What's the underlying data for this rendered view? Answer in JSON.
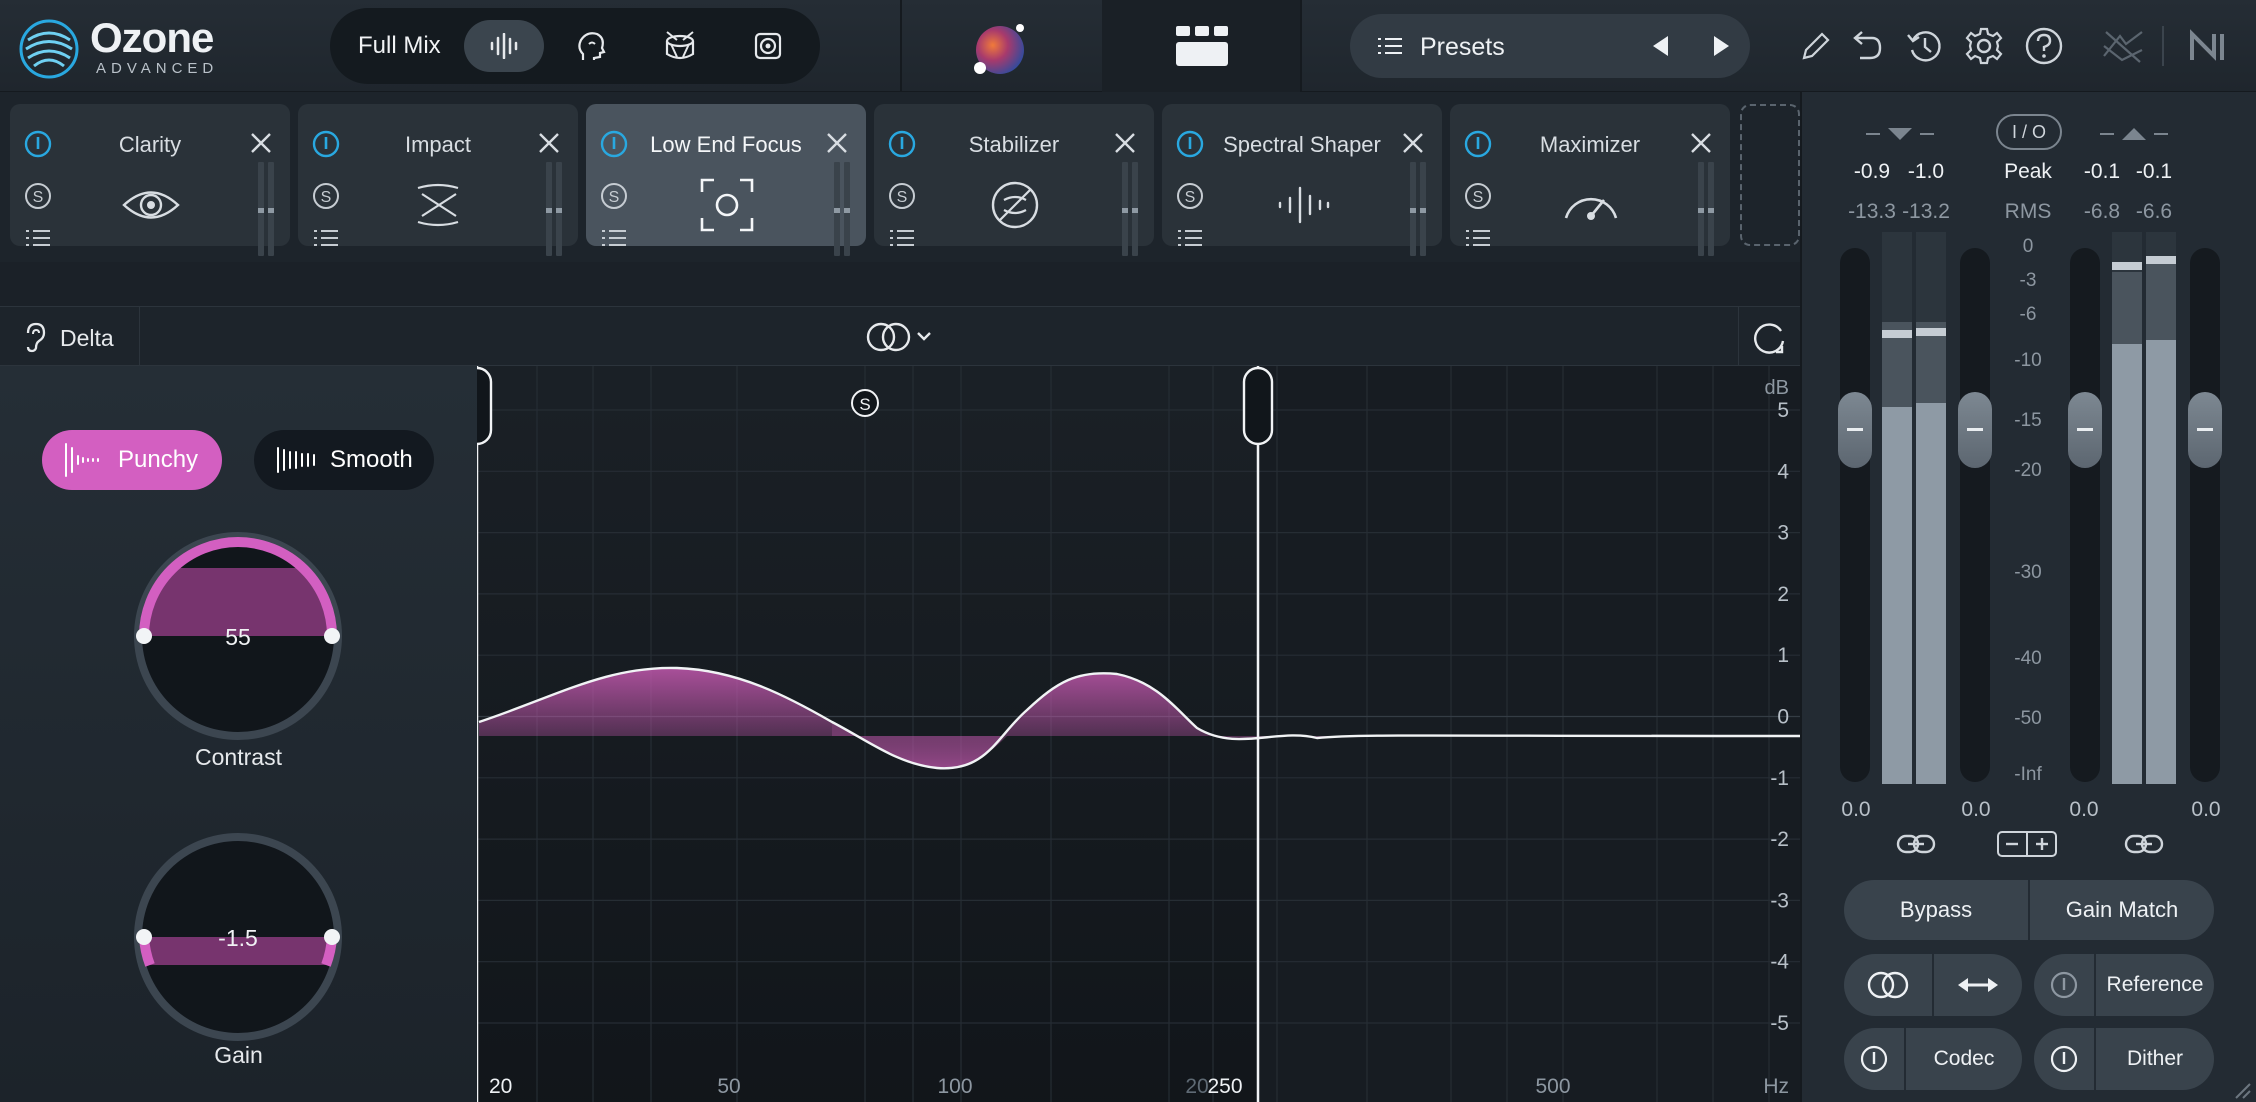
{
  "app": {
    "name": "Ozone",
    "edition": "ADVANCED",
    "accent_color": "#d35fc1",
    "focus_color": "#29a8e0"
  },
  "topbar": {
    "mix_label": "Full Mix",
    "mix_targets": [
      "waveform-icon",
      "vocal-head-icon",
      "drum-icon",
      "speaker-icon"
    ],
    "presets_label": "Presets",
    "tools": [
      "pencil-icon",
      "undo-icon",
      "history-icon",
      "gear-icon",
      "help-icon",
      "assistant-off-icon",
      "ni-logo-icon"
    ]
  },
  "modules": [
    {
      "name": "Clarity",
      "icon": "eye-icon",
      "selected": false
    },
    {
      "name": "Impact",
      "icon": "impact-icon",
      "selected": false
    },
    {
      "name": "Low End Focus",
      "icon": "focus-frame-icon",
      "selected": true
    },
    {
      "name": "Stabilizer",
      "icon": "stabilizer-icon",
      "selected": false
    },
    {
      "name": "Spectral Shaper",
      "icon": "spectral-icon",
      "selected": false
    },
    {
      "name": "Maximizer",
      "icon": "gauge-icon",
      "selected": false
    }
  ],
  "module_bar": {
    "delta_label": "Delta"
  },
  "low_end_focus": {
    "mode_punchy": "Punchy",
    "mode_smooth": "Smooth",
    "active_mode": "Punchy",
    "contrast": {
      "label": "Contrast",
      "value": "55"
    },
    "gain": {
      "label": "Gain",
      "value": "-1.5"
    }
  },
  "graph": {
    "db_unit": "dB",
    "db_ticks": [
      "5",
      "4",
      "3",
      "2",
      "1",
      "0",
      "-1",
      "-2",
      "-3",
      "-4",
      "-5"
    ],
    "freq_unit": "Hz",
    "freq_ticks": [
      "20",
      "50",
      "100",
      "20",
      "250",
      "500"
    ],
    "solo_label": "S"
  },
  "meters": {
    "input_peak_l": "-0.9",
    "input_peak_r": "-1.0",
    "input_rms_l": "-13.3",
    "input_rms_r": "-13.2",
    "output_peak_l": "-0.1",
    "output_peak_r": "-0.1",
    "output_rms_l": "-6.8",
    "output_rms_r": "-6.6",
    "peak_label": "Peak",
    "rms_label": "RMS",
    "io_label": "I / O",
    "scale": [
      "0",
      "-3",
      "-6",
      "-10",
      "-15",
      "-20",
      "-30",
      "-40",
      "-50",
      "-Inf"
    ],
    "fader_in_l": "0.0",
    "fader_in_r": "0.0",
    "fader_out_l": "0.0",
    "fader_out_r": "0.0"
  },
  "bottom_controls": {
    "bypass": "Bypass",
    "gain_match": "Gain Match",
    "reference": "Reference",
    "codec": "Codec",
    "dither": "Dither"
  }
}
